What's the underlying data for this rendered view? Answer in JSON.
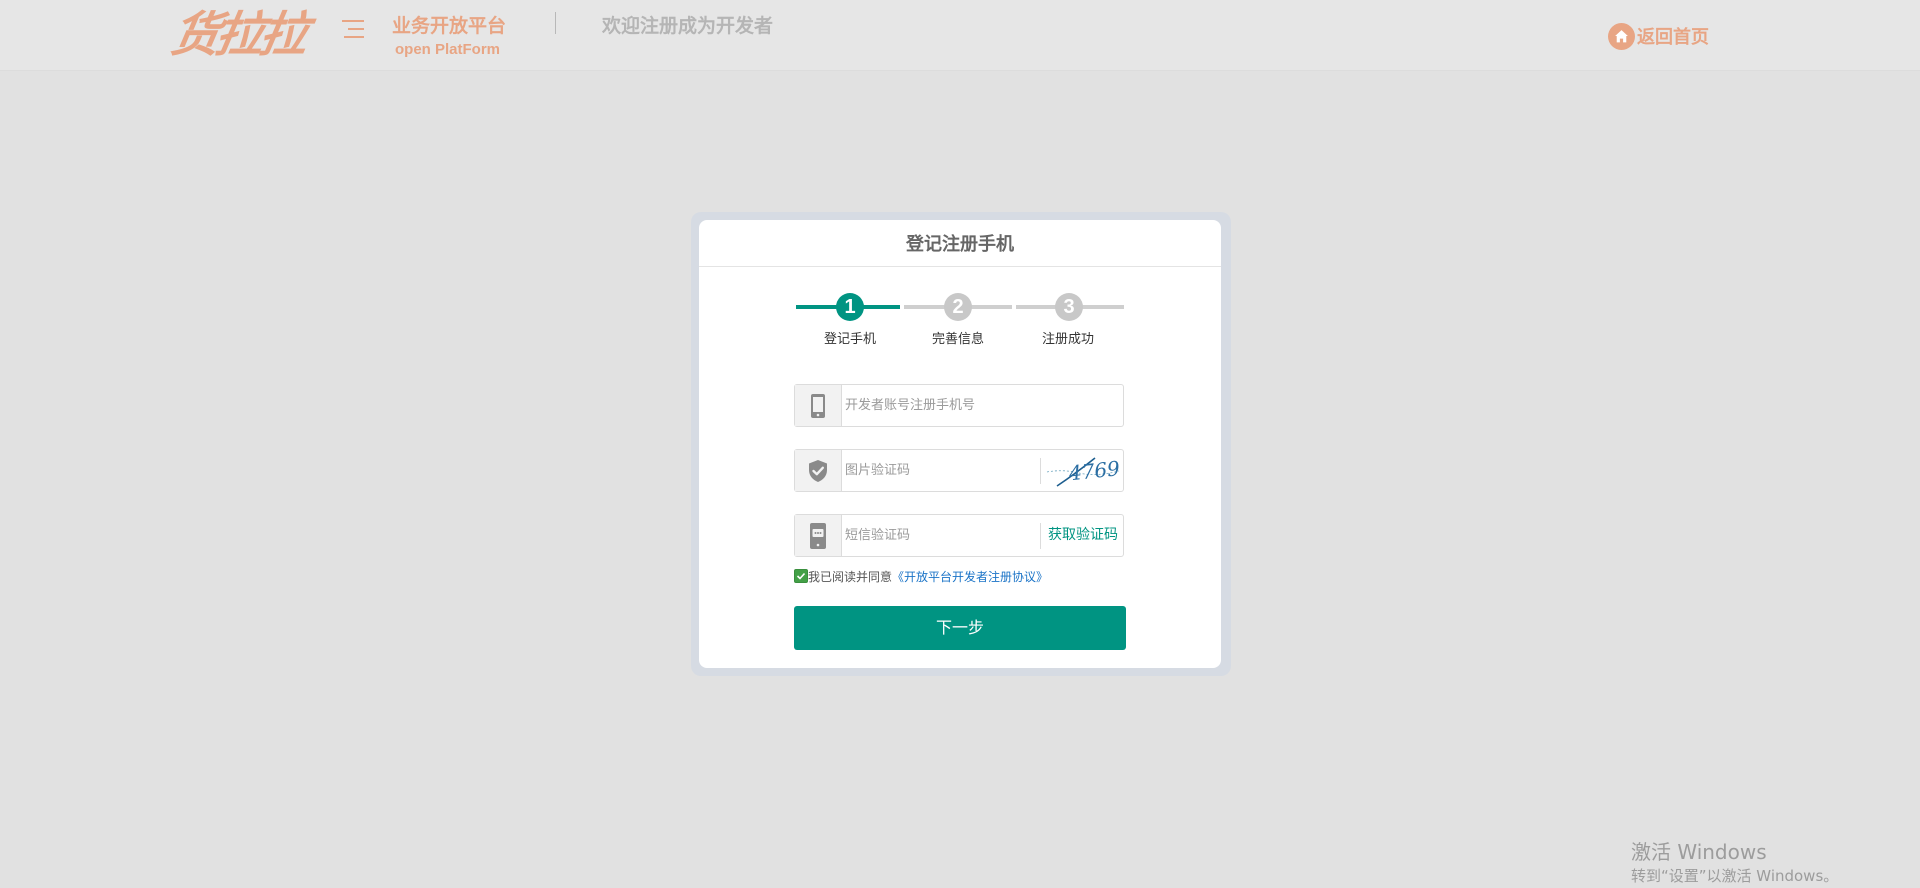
{
  "header": {
    "logo_text": "货拉拉",
    "platform_name": "业务开放平台",
    "platform_sub": "open PlatForm",
    "welcome": "欢迎注册成为开发者",
    "home_link": "返回首页"
  },
  "card": {
    "title": "登记注册手机",
    "steps": [
      {
        "number": "1",
        "label": "登记手机",
        "status": "active"
      },
      {
        "number": "2",
        "label": "完善信息",
        "status": "pending"
      },
      {
        "number": "3",
        "label": "注册成功",
        "status": "pending"
      }
    ],
    "phone": {
      "placeholder": "开发者账号注册手机号",
      "value": ""
    },
    "captcha": {
      "placeholder": "图片验证码",
      "value": "",
      "image_text": "4769"
    },
    "sms": {
      "placeholder": "短信验证码",
      "value": "",
      "button_label": "获取验证码"
    },
    "agreement": {
      "checked": true,
      "text": "我已阅读并同意",
      "link": "《开放平台开发者注册协议》"
    },
    "next_button": "下一步"
  },
  "watermark": {
    "title": "激活 Windows",
    "subtitle": "转到“设置”以激活 Windows。"
  },
  "colors": {
    "brand": "#e8a584",
    "accent": "#009482",
    "background": "#e1e1e1",
    "link": "#1a73c7"
  },
  "icons": {
    "home": "home-icon",
    "phone": "phone-icon",
    "captcha": "shield-check-icon",
    "sms": "sms-icon",
    "checkbox": "check-icon"
  }
}
